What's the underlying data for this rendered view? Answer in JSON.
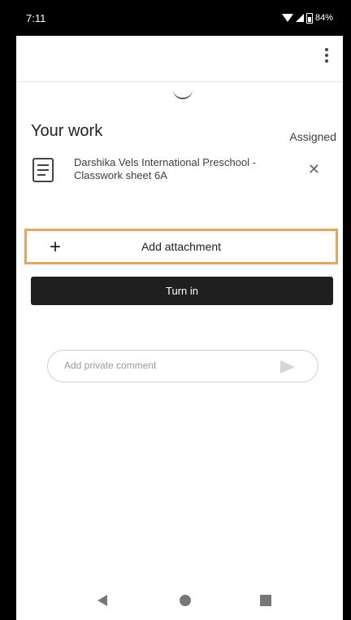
{
  "status_bar": {
    "time": "7:11",
    "battery": "84%"
  },
  "work": {
    "title": "Your work",
    "status": "Assigned",
    "attachment": {
      "title": "Darshika Vels International Preschool - Classwork sheet 6A",
      "icon": "document-icon"
    }
  },
  "actions": {
    "add_attachment_label": "Add attachment",
    "turn_in_label": "Turn in"
  },
  "comment": {
    "placeholder": "Add private comment"
  },
  "colors": {
    "highlight_border": "#e3a55f",
    "turn_in_bg": "#1f1f1f"
  }
}
